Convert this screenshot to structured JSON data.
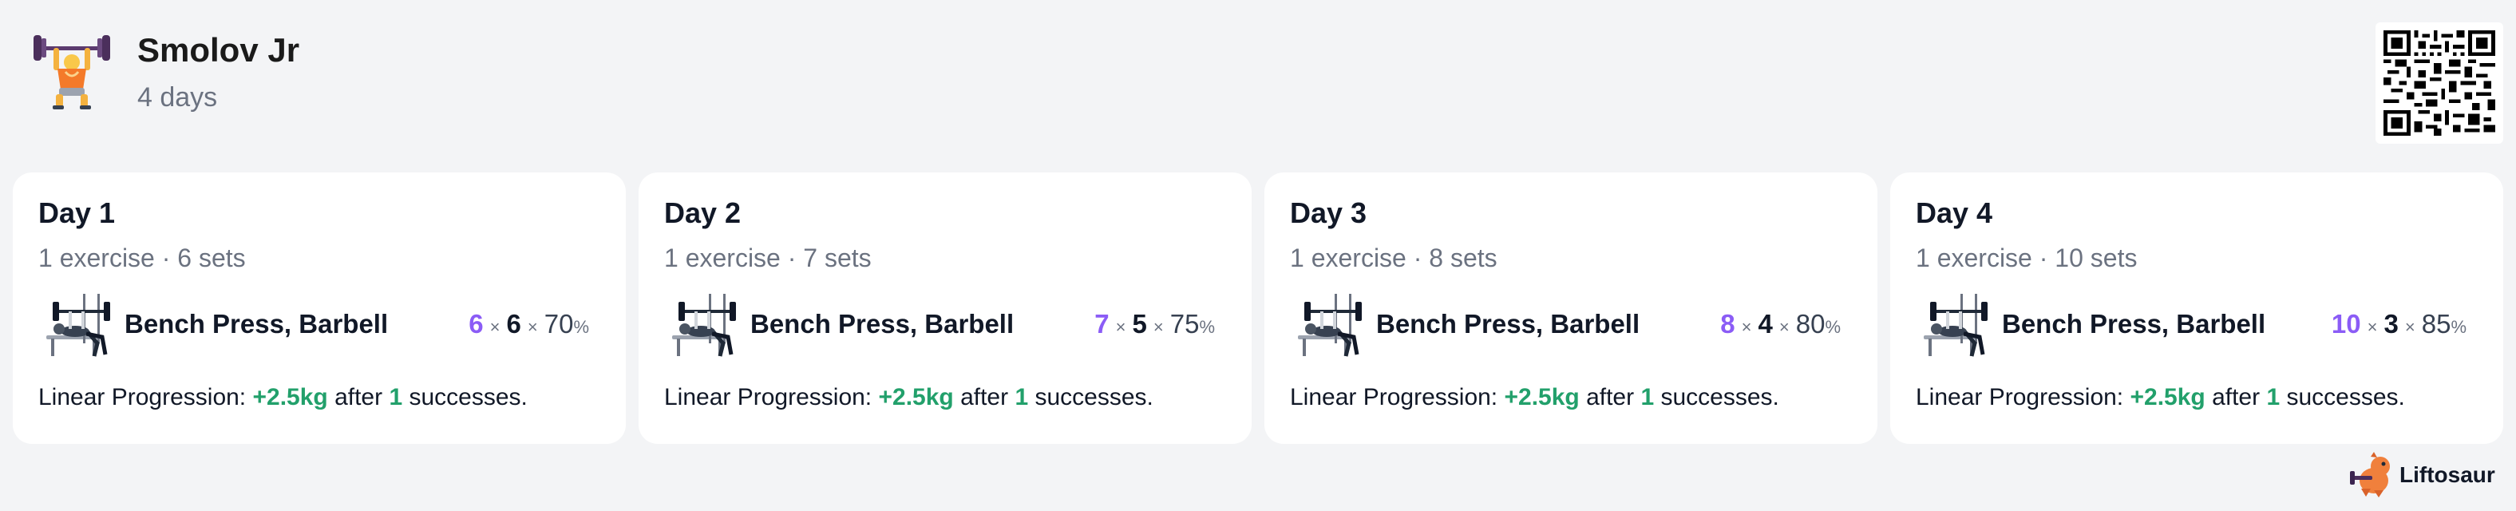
{
  "program": {
    "title": "Smolov Jr",
    "subtitle": "4 days",
    "icon": "weightlifter-icon"
  },
  "qr": {
    "icon": "qr-code-icon"
  },
  "days": [
    {
      "title": "Day 1",
      "summary": "1 exercise · 6 sets",
      "exercise": {
        "name": "Bench Press, Barbell",
        "icon": "bench-press-icon"
      },
      "sets": "6",
      "times1": "×",
      "reps": "6",
      "times2": "×",
      "percent": "70",
      "percent_sign": "%",
      "progression": {
        "label": "Linear Progression:",
        "increment": "+2.5kg",
        "after": "after",
        "count": "1",
        "suffix": "successes."
      }
    },
    {
      "title": "Day 2",
      "summary": "1 exercise · 7 sets",
      "exercise": {
        "name": "Bench Press, Barbell",
        "icon": "bench-press-icon"
      },
      "sets": "7",
      "times1": "×",
      "reps": "5",
      "times2": "×",
      "percent": "75",
      "percent_sign": "%",
      "progression": {
        "label": "Linear Progression:",
        "increment": "+2.5kg",
        "after": "after",
        "count": "1",
        "suffix": "successes."
      }
    },
    {
      "title": "Day 3",
      "summary": "1 exercise · 8 sets",
      "exercise": {
        "name": "Bench Press, Barbell",
        "icon": "bench-press-icon"
      },
      "sets": "8",
      "times1": "×",
      "reps": "4",
      "times2": "×",
      "percent": "80",
      "percent_sign": "%",
      "progression": {
        "label": "Linear Progression:",
        "increment": "+2.5kg",
        "after": "after",
        "count": "1",
        "suffix": "successes."
      }
    },
    {
      "title": "Day 4",
      "summary": "1 exercise · 10 sets",
      "exercise": {
        "name": "Bench Press, Barbell",
        "icon": "bench-press-icon"
      },
      "sets": "10",
      "times1": "×",
      "reps": "3",
      "times2": "×",
      "percent": "85",
      "percent_sign": "%",
      "progression": {
        "label": "Linear Progression:",
        "increment": "+2.5kg",
        "after": "after",
        "count": "1",
        "suffix": "successes."
      }
    }
  ],
  "brand": {
    "name": "Liftosaur",
    "icon": "dinosaur-logo-icon"
  },
  "colors": {
    "background": "#f3f4f6",
    "card": "#ffffff",
    "sets_accent": "#8b5cf6",
    "progression_accent": "#22a06b",
    "muted_text": "#6b7280"
  }
}
